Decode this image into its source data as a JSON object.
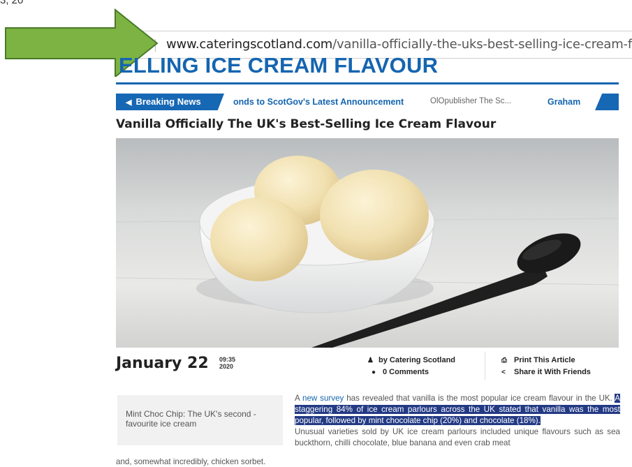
{
  "corner_text": "3, 20",
  "browser": {
    "url_host": "www.cateringscotland.com",
    "url_path": "/vanilla-officially-the-uks-best-selling-ice-cream-flavo"
  },
  "site": {
    "title_fragment": "ELLING ICE CREAM FLAVOUR",
    "accent_color": "#1565b0"
  },
  "ticker": {
    "badge_label": "Breaking News",
    "items": [
      "onds to ScotGov's Latest Announcement",
      "OlOpublisher The Sc...",
      "Graham"
    ]
  },
  "article": {
    "headline": "Vanilla Officially The UK's Best-Selling Ice Cream Flavour",
    "date": "January 22",
    "time": "09:35",
    "year": "2020",
    "author": "by Catering Scotland",
    "comments": "0 Comments",
    "print_label": "Print This Article",
    "share_label": "Share it With Friends",
    "pullquote": "Mint Choc Chip: The UK's second -favourite ice cream",
    "para1_intro": "A ",
    "para1_link": "new survey",
    "para1_rest": " has revealed that vanilla is the most popular ice cream flavour in the UK. ",
    "para1_highlight": "A staggering 84% of ice cream parlours across the UK stated that vanilla was the most popular, followed by mint chocolate chip (20%) and chocolate (18%).",
    "para2": "Unusual varieties sold by UK ice cream parlours included unique flavours such as sea buckthorn, chilli chocolate, blue banana and even crab meat",
    "para2_tail": "and, somewhat incredibly, chicken sorbet."
  },
  "icons": {
    "arrow": "green-arrow-icon",
    "breaking": "megaphone-icon",
    "author": "user-icon",
    "comments": "comment-icon",
    "print": "printer-icon",
    "share": "share-icon"
  },
  "colors": {
    "arrow_fill": "#7cb342",
    "arrow_stroke": "#4a7a2a",
    "highlight": "#233a84"
  }
}
